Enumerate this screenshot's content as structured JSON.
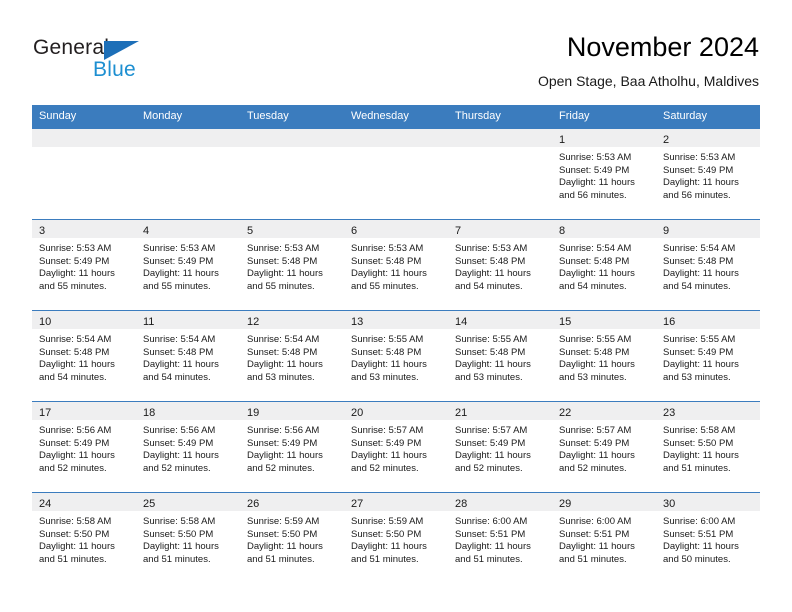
{
  "brand": {
    "name_part1": "General",
    "name_part2": "Blue",
    "triangle_icon": "logo-triangle-icon",
    "accent_blue": "#1d8fd1",
    "dark_blue": "#1d6fb8"
  },
  "header": {
    "month_title": "November 2024",
    "subtitle": "Open Stage, Baa Atholhu, Maldives"
  },
  "colors": {
    "header_row_bg": "#3b7cbe",
    "day_band_bg": "#efeff0",
    "text": "#1a1a1a"
  },
  "weekdays": [
    "Sunday",
    "Monday",
    "Tuesday",
    "Wednesday",
    "Thursday",
    "Friday",
    "Saturday"
  ],
  "weeks": [
    [
      {
        "day": "",
        "sunrise": "",
        "sunset": "",
        "daylight": "",
        "daylight2": ""
      },
      {
        "day": "",
        "sunrise": "",
        "sunset": "",
        "daylight": "",
        "daylight2": ""
      },
      {
        "day": "",
        "sunrise": "",
        "sunset": "",
        "daylight": "",
        "daylight2": ""
      },
      {
        "day": "",
        "sunrise": "",
        "sunset": "",
        "daylight": "",
        "daylight2": ""
      },
      {
        "day": "",
        "sunrise": "",
        "sunset": "",
        "daylight": "",
        "daylight2": ""
      },
      {
        "day": "1",
        "sunrise": "Sunrise: 5:53 AM",
        "sunset": "Sunset: 5:49 PM",
        "daylight": "Daylight: 11 hours",
        "daylight2": "and 56 minutes."
      },
      {
        "day": "2",
        "sunrise": "Sunrise: 5:53 AM",
        "sunset": "Sunset: 5:49 PM",
        "daylight": "Daylight: 11 hours",
        "daylight2": "and 56 minutes."
      }
    ],
    [
      {
        "day": "3",
        "sunrise": "Sunrise: 5:53 AM",
        "sunset": "Sunset: 5:49 PM",
        "daylight": "Daylight: 11 hours",
        "daylight2": "and 55 minutes."
      },
      {
        "day": "4",
        "sunrise": "Sunrise: 5:53 AM",
        "sunset": "Sunset: 5:49 PM",
        "daylight": "Daylight: 11 hours",
        "daylight2": "and 55 minutes."
      },
      {
        "day": "5",
        "sunrise": "Sunrise: 5:53 AM",
        "sunset": "Sunset: 5:48 PM",
        "daylight": "Daylight: 11 hours",
        "daylight2": "and 55 minutes."
      },
      {
        "day": "6",
        "sunrise": "Sunrise: 5:53 AM",
        "sunset": "Sunset: 5:48 PM",
        "daylight": "Daylight: 11 hours",
        "daylight2": "and 55 minutes."
      },
      {
        "day": "7",
        "sunrise": "Sunrise: 5:53 AM",
        "sunset": "Sunset: 5:48 PM",
        "daylight": "Daylight: 11 hours",
        "daylight2": "and 54 minutes."
      },
      {
        "day": "8",
        "sunrise": "Sunrise: 5:54 AM",
        "sunset": "Sunset: 5:48 PM",
        "daylight": "Daylight: 11 hours",
        "daylight2": "and 54 minutes."
      },
      {
        "day": "9",
        "sunrise": "Sunrise: 5:54 AM",
        "sunset": "Sunset: 5:48 PM",
        "daylight": "Daylight: 11 hours",
        "daylight2": "and 54 minutes."
      }
    ],
    [
      {
        "day": "10",
        "sunrise": "Sunrise: 5:54 AM",
        "sunset": "Sunset: 5:48 PM",
        "daylight": "Daylight: 11 hours",
        "daylight2": "and 54 minutes."
      },
      {
        "day": "11",
        "sunrise": "Sunrise: 5:54 AM",
        "sunset": "Sunset: 5:48 PM",
        "daylight": "Daylight: 11 hours",
        "daylight2": "and 54 minutes."
      },
      {
        "day": "12",
        "sunrise": "Sunrise: 5:54 AM",
        "sunset": "Sunset: 5:48 PM",
        "daylight": "Daylight: 11 hours",
        "daylight2": "and 53 minutes."
      },
      {
        "day": "13",
        "sunrise": "Sunrise: 5:55 AM",
        "sunset": "Sunset: 5:48 PM",
        "daylight": "Daylight: 11 hours",
        "daylight2": "and 53 minutes."
      },
      {
        "day": "14",
        "sunrise": "Sunrise: 5:55 AM",
        "sunset": "Sunset: 5:48 PM",
        "daylight": "Daylight: 11 hours",
        "daylight2": "and 53 minutes."
      },
      {
        "day": "15",
        "sunrise": "Sunrise: 5:55 AM",
        "sunset": "Sunset: 5:48 PM",
        "daylight": "Daylight: 11 hours",
        "daylight2": "and 53 minutes."
      },
      {
        "day": "16",
        "sunrise": "Sunrise: 5:55 AM",
        "sunset": "Sunset: 5:49 PM",
        "daylight": "Daylight: 11 hours",
        "daylight2": "and 53 minutes."
      }
    ],
    [
      {
        "day": "17",
        "sunrise": "Sunrise: 5:56 AM",
        "sunset": "Sunset: 5:49 PM",
        "daylight": "Daylight: 11 hours",
        "daylight2": "and 52 minutes."
      },
      {
        "day": "18",
        "sunrise": "Sunrise: 5:56 AM",
        "sunset": "Sunset: 5:49 PM",
        "daylight": "Daylight: 11 hours",
        "daylight2": "and 52 minutes."
      },
      {
        "day": "19",
        "sunrise": "Sunrise: 5:56 AM",
        "sunset": "Sunset: 5:49 PM",
        "daylight": "Daylight: 11 hours",
        "daylight2": "and 52 minutes."
      },
      {
        "day": "20",
        "sunrise": "Sunrise: 5:57 AM",
        "sunset": "Sunset: 5:49 PM",
        "daylight": "Daylight: 11 hours",
        "daylight2": "and 52 minutes."
      },
      {
        "day": "21",
        "sunrise": "Sunrise: 5:57 AM",
        "sunset": "Sunset: 5:49 PM",
        "daylight": "Daylight: 11 hours",
        "daylight2": "and 52 minutes."
      },
      {
        "day": "22",
        "sunrise": "Sunrise: 5:57 AM",
        "sunset": "Sunset: 5:49 PM",
        "daylight": "Daylight: 11 hours",
        "daylight2": "and 52 minutes."
      },
      {
        "day": "23",
        "sunrise": "Sunrise: 5:58 AM",
        "sunset": "Sunset: 5:50 PM",
        "daylight": "Daylight: 11 hours",
        "daylight2": "and 51 minutes."
      }
    ],
    [
      {
        "day": "24",
        "sunrise": "Sunrise: 5:58 AM",
        "sunset": "Sunset: 5:50 PM",
        "daylight": "Daylight: 11 hours",
        "daylight2": "and 51 minutes."
      },
      {
        "day": "25",
        "sunrise": "Sunrise: 5:58 AM",
        "sunset": "Sunset: 5:50 PM",
        "daylight": "Daylight: 11 hours",
        "daylight2": "and 51 minutes."
      },
      {
        "day": "26",
        "sunrise": "Sunrise: 5:59 AM",
        "sunset": "Sunset: 5:50 PM",
        "daylight": "Daylight: 11 hours",
        "daylight2": "and 51 minutes."
      },
      {
        "day": "27",
        "sunrise": "Sunrise: 5:59 AM",
        "sunset": "Sunset: 5:50 PM",
        "daylight": "Daylight: 11 hours",
        "daylight2": "and 51 minutes."
      },
      {
        "day": "28",
        "sunrise": "Sunrise: 6:00 AM",
        "sunset": "Sunset: 5:51 PM",
        "daylight": "Daylight: 11 hours",
        "daylight2": "and 51 minutes."
      },
      {
        "day": "29",
        "sunrise": "Sunrise: 6:00 AM",
        "sunset": "Sunset: 5:51 PM",
        "daylight": "Daylight: 11 hours",
        "daylight2": "and 51 minutes."
      },
      {
        "day": "30",
        "sunrise": "Sunrise: 6:00 AM",
        "sunset": "Sunset: 5:51 PM",
        "daylight": "Daylight: 11 hours",
        "daylight2": "and 50 minutes."
      }
    ]
  ]
}
